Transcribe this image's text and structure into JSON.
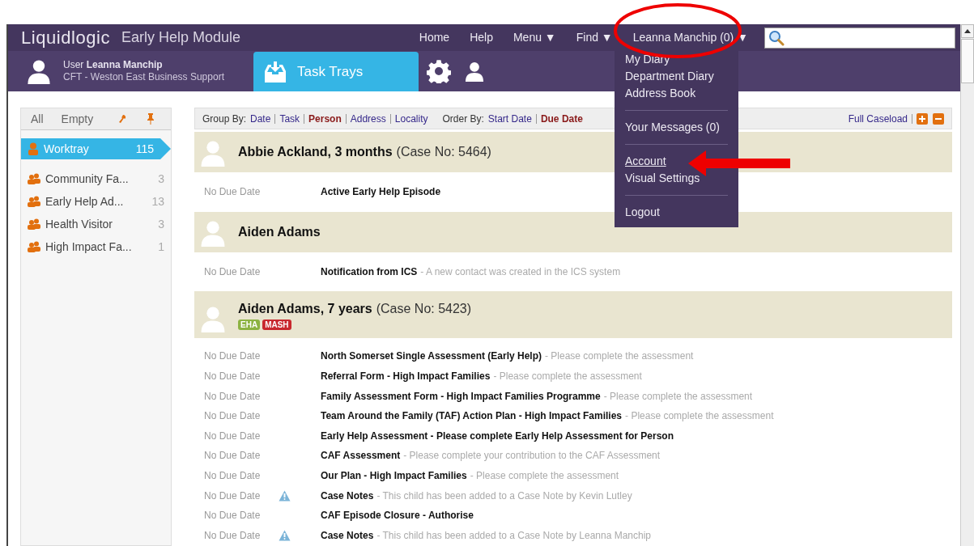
{
  "header": {
    "logo": "Liquidlogic",
    "module": "Early Help Module",
    "nav": [
      {
        "label": "Home"
      },
      {
        "label": "Help"
      },
      {
        "label": "Menu ▼"
      },
      {
        "label": "Find ▼"
      },
      {
        "label": "Leanna Manchip (0) ▼"
      }
    ]
  },
  "user_bar": {
    "user": "User **Leanna Manchip**",
    "team": "CFT - Weston East Business Support",
    "tab": "Task Trays"
  },
  "user_menu": {
    "items": [
      {
        "label": "My Diary",
        "underlined": false,
        "divider_before": false
      },
      {
        "label": "Department Diary",
        "underlined": false,
        "divider_before": false
      },
      {
        "label": "Address Book",
        "underlined": false,
        "divider_before": false
      },
      {
        "label": "Your Messages (0)",
        "underlined": false,
        "divider_before": true
      },
      {
        "label": "Account",
        "underlined": true,
        "divider_before": true
      },
      {
        "label": "Visual Settings",
        "underlined": false,
        "divider_before": false
      },
      {
        "label": "Logout",
        "underlined": false,
        "divider_before": true
      }
    ]
  },
  "sidebar": {
    "filters": [
      {
        "label": "All",
        "selected": false
      },
      {
        "label": "Empty",
        "selected": false
      }
    ],
    "trays": [
      {
        "label": "Worktray",
        "count": "115",
        "selected": true,
        "kind": "personal"
      },
      {
        "label": "Community Fa...",
        "count": "3",
        "selected": false,
        "kind": "team"
      },
      {
        "label": "Early Help Ad...",
        "count": "13",
        "selected": false,
        "kind": "team"
      },
      {
        "label": "Health Visitor",
        "count": "3",
        "selected": false,
        "kind": "team"
      },
      {
        "label": "High Impact Fa...",
        "count": "1",
        "selected": false,
        "kind": "team"
      }
    ]
  },
  "toolbar": {
    "group_by_label": "Group By:",
    "group_by": [
      {
        "label": "Date",
        "selected": false
      },
      {
        "label": "Task",
        "selected": false
      },
      {
        "label": "Person",
        "selected": true
      },
      {
        "label": "Address",
        "selected": false
      },
      {
        "label": "Locality",
        "selected": false
      }
    ],
    "order_by_label": "Order By:",
    "order_by": [
      {
        "label": "Start Date",
        "selected": false
      },
      {
        "label": "Due Date",
        "selected": true
      }
    ],
    "full_caseload": "Full Caseload"
  },
  "people": [
    {
      "name": "Abbie Ackland, 3 months",
      "case": "(Case No: 5464)",
      "tasks": [
        {
          "due": "No Due Date",
          "warning": false,
          "title": "Active Early Help Episode"
        }
      ]
    },
    {
      "name": "Aiden Adams",
      "tasks": [
        {
          "due": "No Due Date",
          "warning": false,
          "title": "Notification from ICS",
          "detail": "- A new contact was created in the ICS system"
        }
      ]
    },
    {
      "name": "Aiden Adams, 7 years",
      "case": "(Case No: 5423)",
      "tags": [
        {
          "label": "EHA",
          "color": "#8cb342"
        },
        {
          "label": "MASH",
          "color": "#c8282e"
        }
      ],
      "tasks": [
        {
          "due": "No Due Date",
          "warning": false,
          "title": "North Somerset Single Assessment (Early Help)",
          "detail": "- Please complete the assessment"
        },
        {
          "due": "No Due Date",
          "warning": false,
          "title": "Referral Form - High Impact Families",
          "detail": "- Please complete the assessment"
        },
        {
          "due": "No Due Date",
          "warning": false,
          "title": "Family Assessment Form - High Impact Families Programme",
          "detail": "- Please complete the assessment"
        },
        {
          "due": "No Due Date",
          "warning": false,
          "title": "Team Around the Family (TAF) Action Plan - High Impact Families",
          "detail": "- Please complete the assessment"
        },
        {
          "due": "No Due Date",
          "warning": false,
          "title": "Early Help Assessment - Please complete Early Help Assessment for Person"
        },
        {
          "due": "No Due Date",
          "warning": false,
          "title": "CAF Assessment",
          "detail": "- Please complete your contribution to the CAF Assessment"
        },
        {
          "due": "No Due Date",
          "warning": false,
          "title": "Our Plan - High Impact Families",
          "detail": "- Please complete the assessment"
        },
        {
          "due": "No Due Date",
          "warning": true,
          "title": "Case Notes",
          "detail": "- This child has been added to a Case Note by Kevin Lutley"
        },
        {
          "due": "No Due Date",
          "warning": false,
          "title": "CAF Episode Closure - Authorise"
        },
        {
          "due": "No Due Date",
          "warning": true,
          "title": "Case Notes",
          "detail": "- This child has been added to a Case Note by Leanna Manchip"
        }
      ]
    }
  ]
}
